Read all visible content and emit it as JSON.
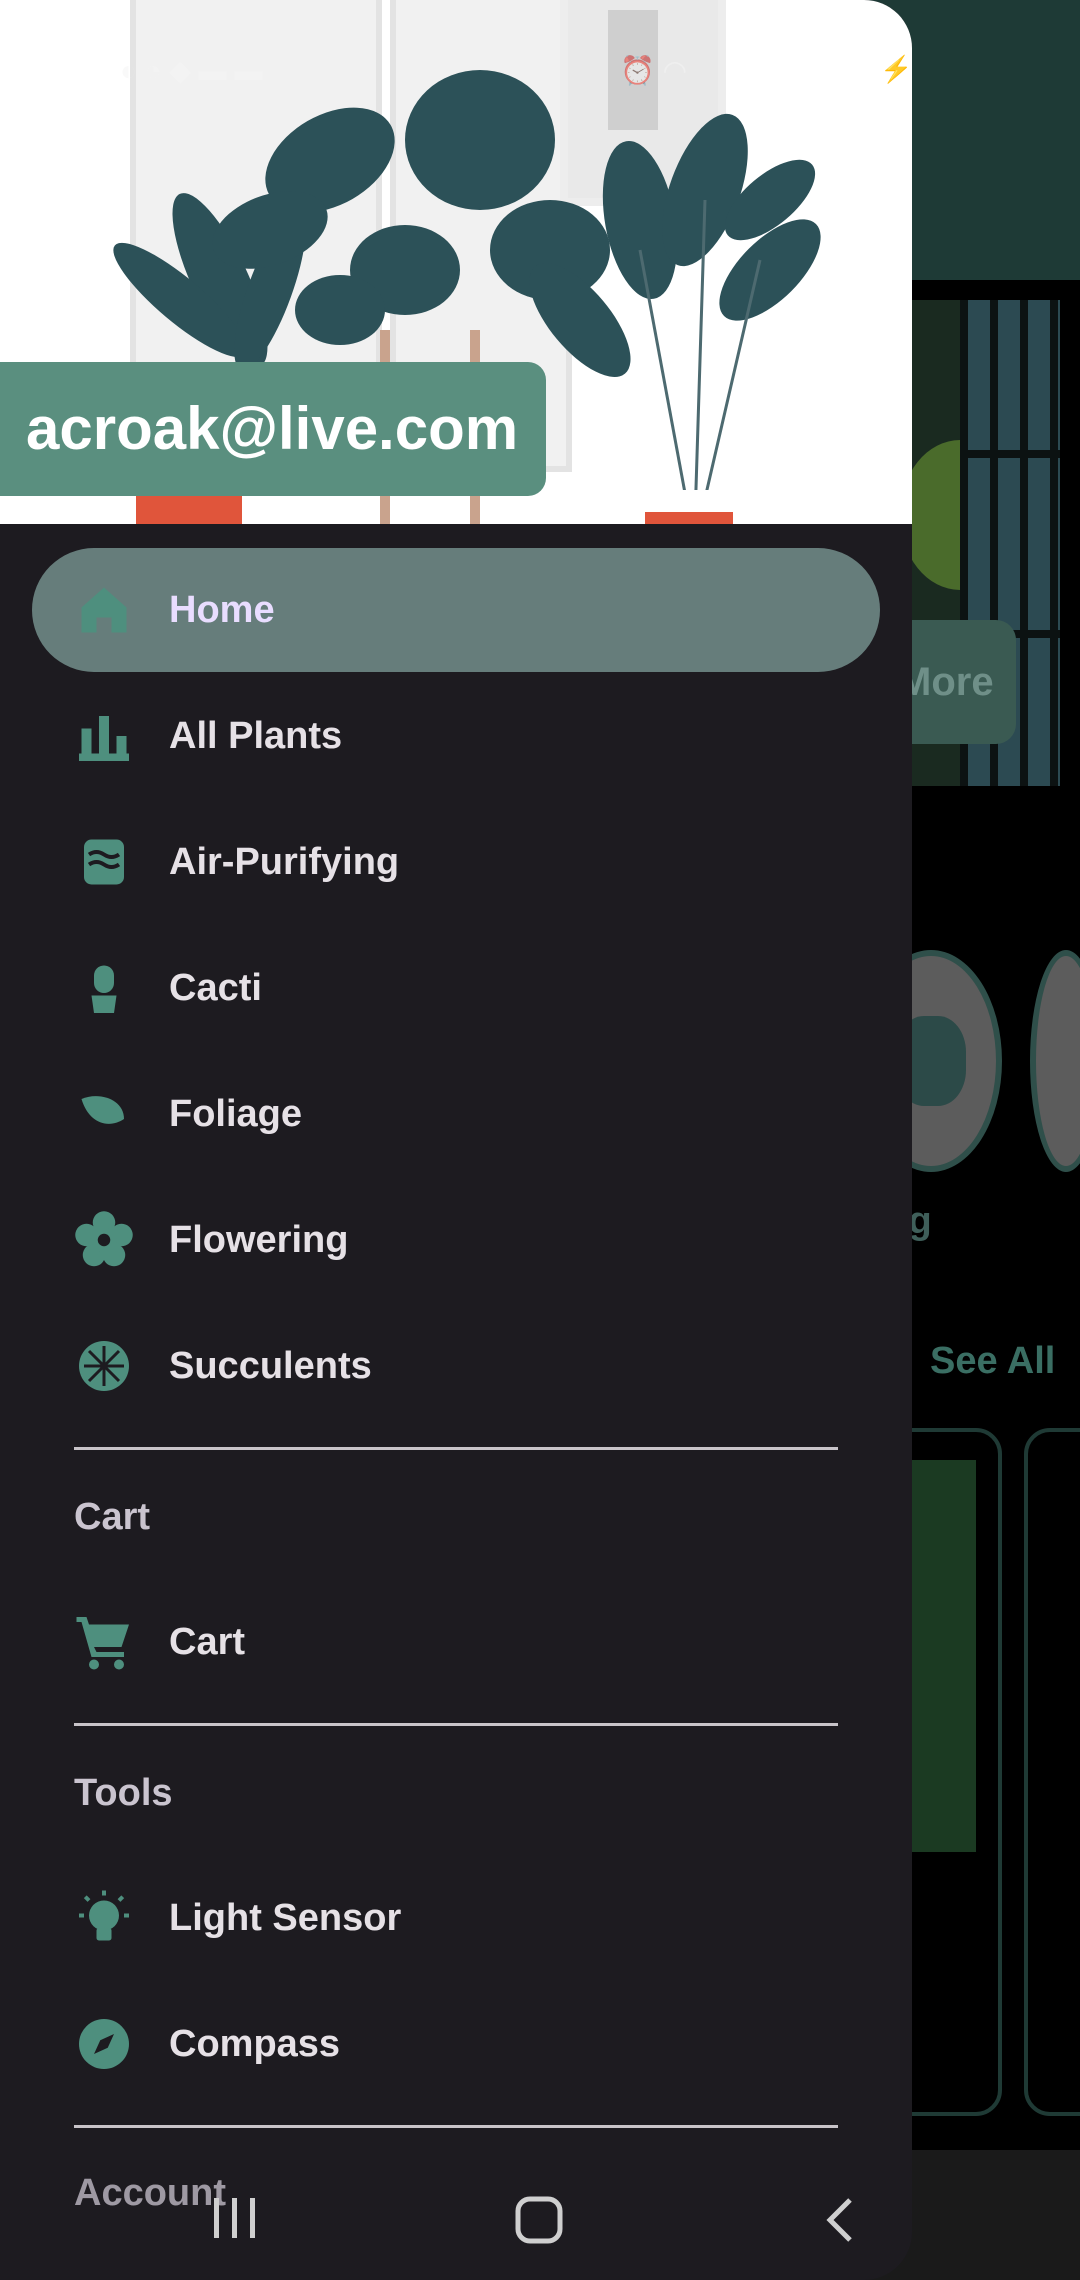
{
  "account": {
    "email": "acroak@live.com"
  },
  "menu": {
    "items": [
      {
        "label": "Home",
        "icon": "home-icon",
        "active": true
      },
      {
        "label": "All Plants",
        "icon": "plants-icon"
      },
      {
        "label": "Air-Purifying",
        "icon": "air-icon"
      },
      {
        "label": "Cacti",
        "icon": "cactus-icon"
      },
      {
        "label": "Foliage",
        "icon": "leaf-icon"
      },
      {
        "label": "Flowering",
        "icon": "flower-icon"
      },
      {
        "label": "Succulents",
        "icon": "succulent-icon"
      }
    ],
    "cart_section": {
      "title": "Cart",
      "items": [
        {
          "label": "Cart",
          "icon": "cart-icon"
        }
      ]
    },
    "tools_section": {
      "title": "Tools",
      "items": [
        {
          "label": "Light Sensor",
          "icon": "lightbulb-icon"
        },
        {
          "label": "Compass",
          "icon": "compass-icon"
        }
      ]
    },
    "account_section": {
      "title": "Account"
    }
  },
  "background": {
    "hero_button": "More",
    "category_label": "ring",
    "see_all": "See All"
  },
  "colors": {
    "accent": "#4e8f7e",
    "active_item": "#667d7b",
    "drawer_bg": "#1d1b20",
    "email_chip": "#5a8f7f"
  }
}
